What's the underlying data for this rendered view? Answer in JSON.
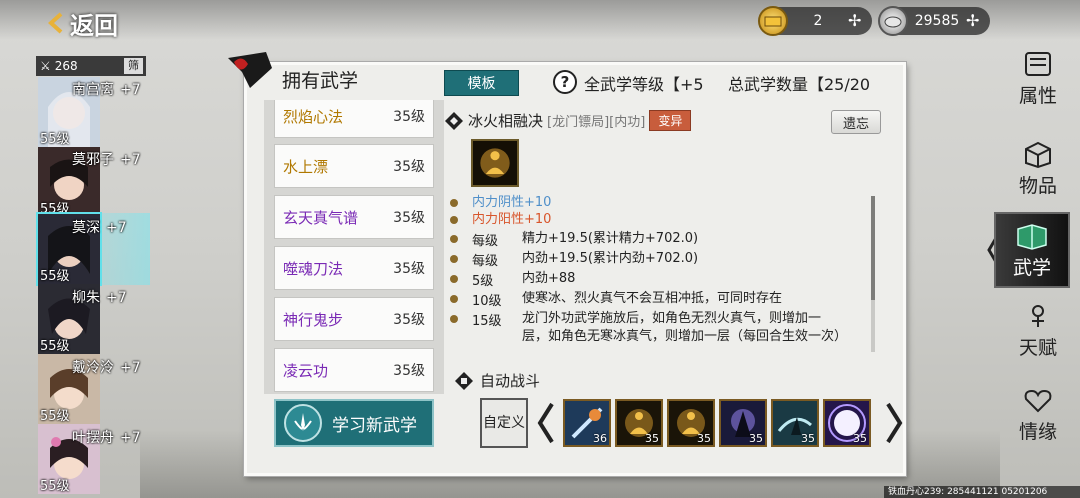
{
  "header": {
    "back_label": "返回"
  },
  "currency": {
    "gold": "2",
    "silver": "29585"
  },
  "roster": {
    "power": "268",
    "sort_label": "筛",
    "characters": [
      {
        "name": "南宫离",
        "bonus": "+7",
        "level": "55级"
      },
      {
        "name": "莫邪子",
        "bonus": "+7",
        "level": "55级"
      },
      {
        "name": "莫深",
        "bonus": "+7",
        "level": "55级"
      },
      {
        "name": "柳朱",
        "bonus": "+7",
        "level": "55级"
      },
      {
        "name": "戴泠泠",
        "bonus": "+7",
        "level": "55级"
      },
      {
        "name": "叶摆舟",
        "bonus": "+7",
        "level": "55级"
      }
    ]
  },
  "panel": {
    "title": "拥有武学",
    "template_button": "模板",
    "total_level_label": "全武学等级【+5",
    "total_count_label": "总武学数量【25/20"
  },
  "skills": [
    {
      "name": "烈焰心法",
      "level": "35级",
      "color": "gold"
    },
    {
      "name": "水上漂",
      "level": "35级",
      "color": "gold"
    },
    {
      "name": "玄天真气谱",
      "level": "35级",
      "color": "purple"
    },
    {
      "name": "噬魂刀法",
      "level": "35级",
      "color": "purple"
    },
    {
      "name": "神行鬼步",
      "level": "35级",
      "color": "purple"
    },
    {
      "name": "凌云功",
      "level": "35级",
      "color": "purple"
    }
  ],
  "learn_button": "学习新武学",
  "detail": {
    "name": "冰火相融决",
    "tags": "[龙门镖局][内功]",
    "mutation": "变异",
    "forget_button": "遗忘",
    "effects": [
      {
        "level": "",
        "text": "内力阴性+10",
        "color": "blue"
      },
      {
        "level": "",
        "text": "内力阳性+10",
        "color": "red"
      },
      {
        "level": "每级",
        "text": "精力+19.5(累计精力+702.0)",
        "color": "normal"
      },
      {
        "level": "每级",
        "text": "内劲+19.5(累计内劲+702.0)",
        "color": "normal"
      },
      {
        "level": "5级",
        "text": "内劲+88",
        "color": "normal"
      },
      {
        "level": "10级",
        "text": "使寒冰、烈火真气不会互相冲抵，可同时存在",
        "color": "normal"
      },
      {
        "level": "15级",
        "text": "龙门外功武学施放后，如角色无烈火真气，则增加一层，如角色无寒冰真气，则增加一层（每回合生效一次）",
        "color": "normal"
      }
    ]
  },
  "auto_battle": {
    "label": "自动战斗",
    "custom_button": "自定义",
    "slots": [
      {
        "count": "36",
        "icon": "skill-icon-ice-blade",
        "color": "#3a6fa8"
      },
      {
        "count": "35",
        "icon": "skill-icon-meditation",
        "color": "#8a6a1a"
      },
      {
        "count": "35",
        "icon": "skill-icon-meditation",
        "color": "#8a6a1a"
      },
      {
        "count": "35",
        "icon": "skill-icon-shadow-strike",
        "color": "#3a3a8a"
      },
      {
        "count": "35",
        "icon": "skill-icon-wind-step",
        "color": "#2e6a7a"
      },
      {
        "count": "35",
        "icon": "skill-icon-burst",
        "color": "#5a3ab0"
      }
    ]
  },
  "nav": [
    {
      "label": "属性",
      "icon": "scroll-icon",
      "active": false
    },
    {
      "label": "物品",
      "icon": "box-icon",
      "active": false
    },
    {
      "label": "武学",
      "icon": "book-icon",
      "active": true
    },
    {
      "label": "天赋",
      "icon": "talent-icon",
      "active": false
    },
    {
      "label": "情缘",
      "icon": "heart-icon",
      "active": false
    }
  ],
  "footer": "铁血丹心239: 285441121  05201206"
}
